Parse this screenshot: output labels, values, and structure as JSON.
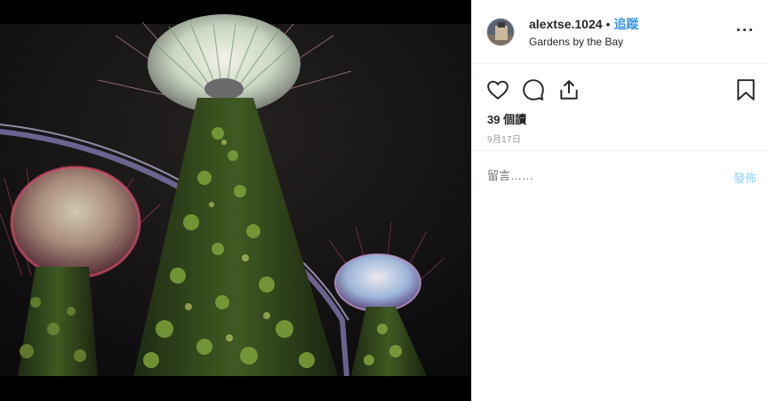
{
  "post": {
    "username": "alextse.1024",
    "separator": "•",
    "follow_label": "追蹤",
    "location": "Gardens by the Bay",
    "more_label": "···",
    "views": "39 個讀",
    "date": "9月17日"
  },
  "comment": {
    "placeholder": "留言……",
    "post_label": "發佈"
  },
  "colors": {
    "link_blue": "#3897f0",
    "post_disabled": "#b2dffc",
    "muted": "#999999",
    "text": "#262626"
  },
  "icons": [
    "heart-icon",
    "comment-icon",
    "share-icon",
    "bookmark-icon",
    "more-options-icon"
  ],
  "image": {
    "subject": "Supertree Grove at night, Gardens by the Bay"
  }
}
